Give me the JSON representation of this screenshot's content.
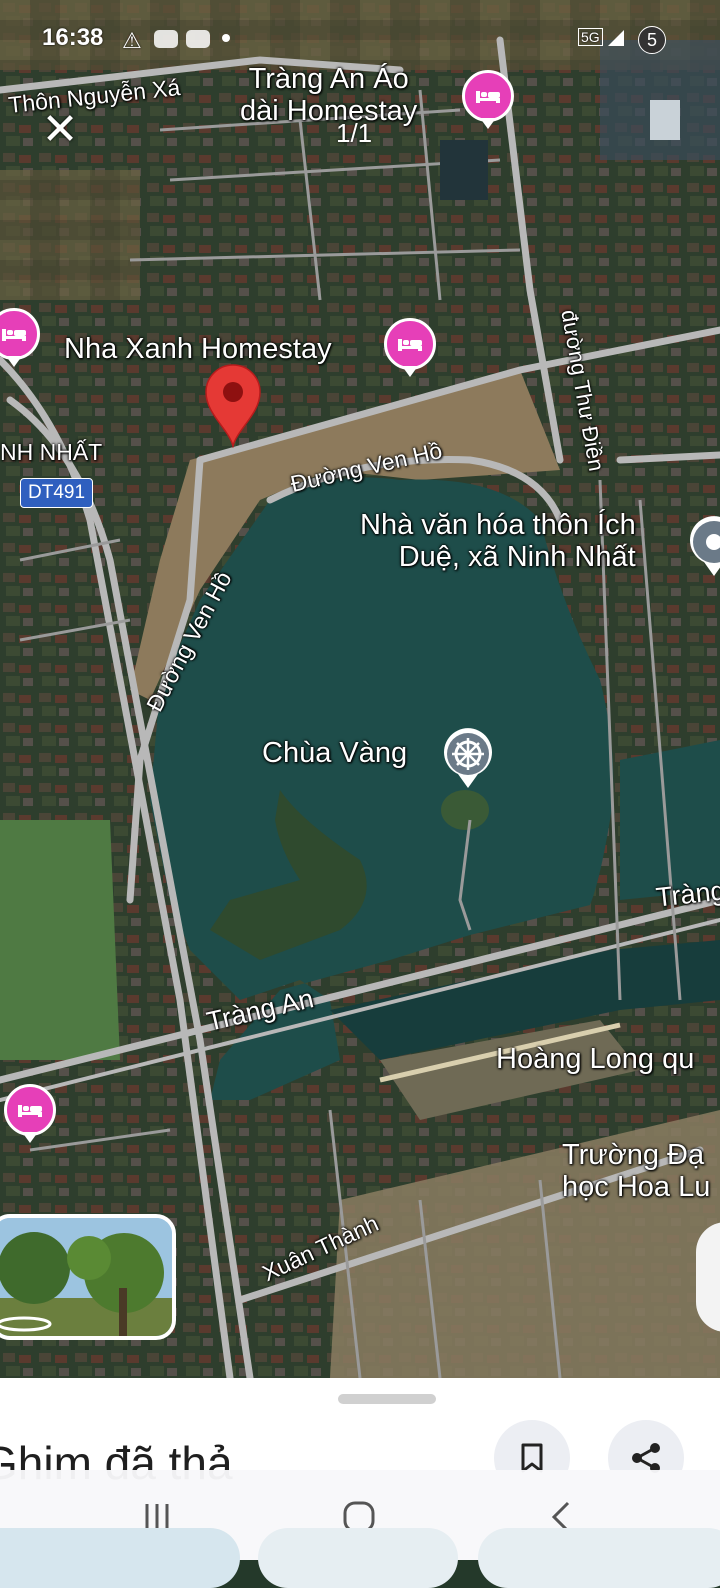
{
  "status_bar": {
    "time": "16:38",
    "signal": "5G",
    "battery": "5"
  },
  "viewer": {
    "close_symbol": "✕",
    "counter": "1/1"
  },
  "map": {
    "type": "satellite",
    "labels": {
      "village": "Thôn Nguyễn Xá",
      "homestay1": "Tràng An Áo\ndài Homestay",
      "homestay2": "Nha Xanh Homestay",
      "ninh_nhat": "NH NHẤT",
      "road_badge": "DT491",
      "ven_ho_top": "Đường Ven Hồ",
      "ven_ho_left": "Đường Ven Hồ",
      "thu_dien": "đường Thư Điền",
      "culture_house": "Nhà văn hóa thôn Ích\nDuệ, xã Ninh Nhất",
      "pagoda": "Chùa Vàng",
      "trang_an_right": "Tràng",
      "trang_an_road": "Tràng An",
      "hoang_long": "Hoàng Long qu",
      "university": "Trường Đạ\nhọc Hoa Lu",
      "xuan_thanh": "Xuân Thành"
    },
    "icons": {
      "hotel": "bed-icon",
      "pin": "dropped-pin-icon",
      "temple": "dharma-wheel-icon",
      "landmark": "landmark-icon"
    },
    "colors": {
      "hotel_pin": "#e63fb8",
      "dropped_pin": "#e53935",
      "lake": "#1e4d4a",
      "road": "#b7b7b7",
      "badge": "#2f5fbf"
    }
  },
  "sheet": {
    "title": "Ghim đã thả",
    "save_icon": "bookmark-icon",
    "share_icon": "share-icon"
  },
  "navbar": {
    "recent_icon": "recent-apps-icon",
    "home_icon": "home-icon",
    "back_icon": "back-icon"
  }
}
